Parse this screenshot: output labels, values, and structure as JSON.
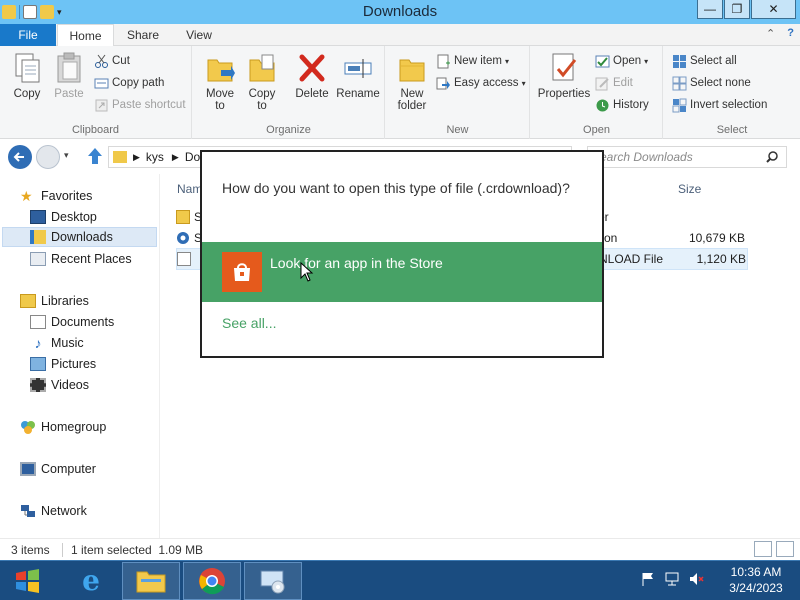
{
  "window": {
    "title": "Downloads"
  },
  "controls": {
    "minimize": "—",
    "maximize": "❐",
    "close": "✕"
  },
  "ribbon_tabs": {
    "file": "File",
    "home": "Home",
    "share": "Share",
    "view": "View"
  },
  "ribbon": {
    "clipboard": {
      "label": "Clipboard",
      "copy": "Copy",
      "paste": "Paste",
      "cut": "Cut",
      "copy_path": "Copy path",
      "paste_shortcut": "Paste shortcut"
    },
    "organize": {
      "label": "Organize",
      "move_to_1": "Move",
      "move_to_2": "to",
      "copy_to_1": "Copy",
      "copy_to_2": "to",
      "delete": "Delete",
      "rename": "Rename"
    },
    "new": {
      "label": "New",
      "new_folder_1": "New",
      "new_folder_2": "folder",
      "new_item": "New item",
      "easy_access": "Easy access"
    },
    "open": {
      "label": "Open",
      "properties": "Properties",
      "open": "Open",
      "edit": "Edit",
      "history": "History"
    },
    "select": {
      "label": "Select",
      "select_all": "Select all",
      "select_none": "Select none",
      "invert_selection": "Invert selection"
    }
  },
  "address": {
    "segments": [
      "kys",
      "Do"
    ],
    "search_placeholder": "Search Downloads"
  },
  "nav": {
    "favorites": "Favorites",
    "desktop": "Desktop",
    "downloads": "Downloads",
    "recent_places": "Recent Places",
    "libraries": "Libraries",
    "documents": "Documents",
    "music": "Music",
    "pictures": "Pictures",
    "videos": "Videos",
    "homegroup": "Homegroup",
    "computer": "Computer",
    "network": "Network"
  },
  "file_list": {
    "columns": {
      "name": "Name",
      "size": "Size"
    },
    "rows": [
      {
        "name": "S",
        "type": "er",
        "size": ""
      },
      {
        "name": "S",
        "type": "tion",
        "size": "10,679 KB"
      },
      {
        "name": "",
        "type": "NLOAD File",
        "size": "1,120 KB"
      }
    ]
  },
  "status": {
    "items": "3 items",
    "selected": "1 item selected  1.09 MB"
  },
  "dialog": {
    "question": "How do you want to open this type of file (.crdownload)?",
    "store_option": "Look for an app in the Store",
    "see_all": "See all..."
  },
  "taskbar": {
    "time": "10:36 AM",
    "date": "3/24/2023"
  },
  "colors": {
    "accent": "#1979ca",
    "store_green": "#47a266",
    "store_orange": "#e55a1c",
    "taskbar": "#1a4c80",
    "titlebar": "#6dc3f5"
  }
}
